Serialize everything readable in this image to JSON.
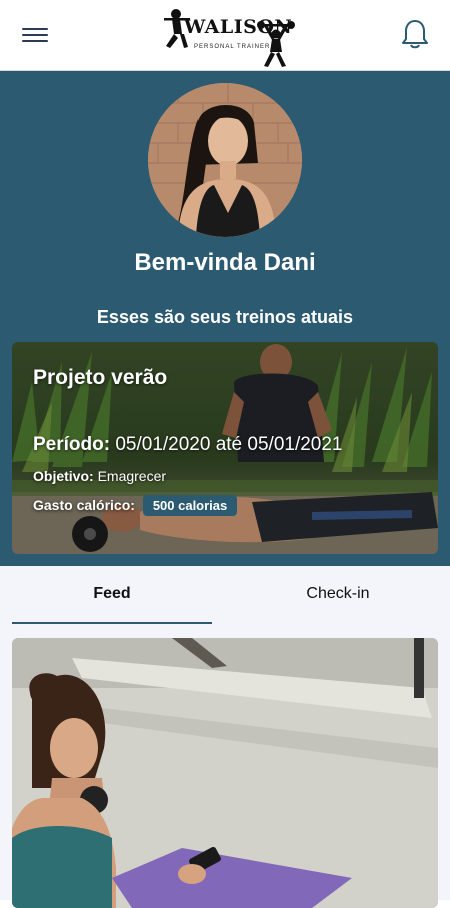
{
  "header": {
    "brand_name": "WALISON",
    "brand_tagline": "PERSONAL TRAINER",
    "icons": [
      "menu-icon",
      "notification-bell-icon"
    ]
  },
  "hero": {
    "greeting": "Bem-vinda Dani",
    "subtitle": "Esses são seus treinos atuais",
    "colors": {
      "background": "#2c5a70",
      "text": "#ffffff"
    }
  },
  "plan": {
    "title": "Projeto verão",
    "period_label": "Período:",
    "period_value": "05/01/2020 até 05/01/2021",
    "goal_label": "Objetivo:",
    "goal_value": "Emagrecer",
    "calories_label": "Gasto calórico:",
    "calories_value": "500 calorias"
  },
  "tabs": [
    {
      "label": "Feed",
      "active": true
    },
    {
      "label": "Check-in",
      "active": false
    }
  ],
  "feed": {
    "items": [
      {
        "image": "woman-with-headphones-and-yoga-mat-photo"
      }
    ]
  }
}
